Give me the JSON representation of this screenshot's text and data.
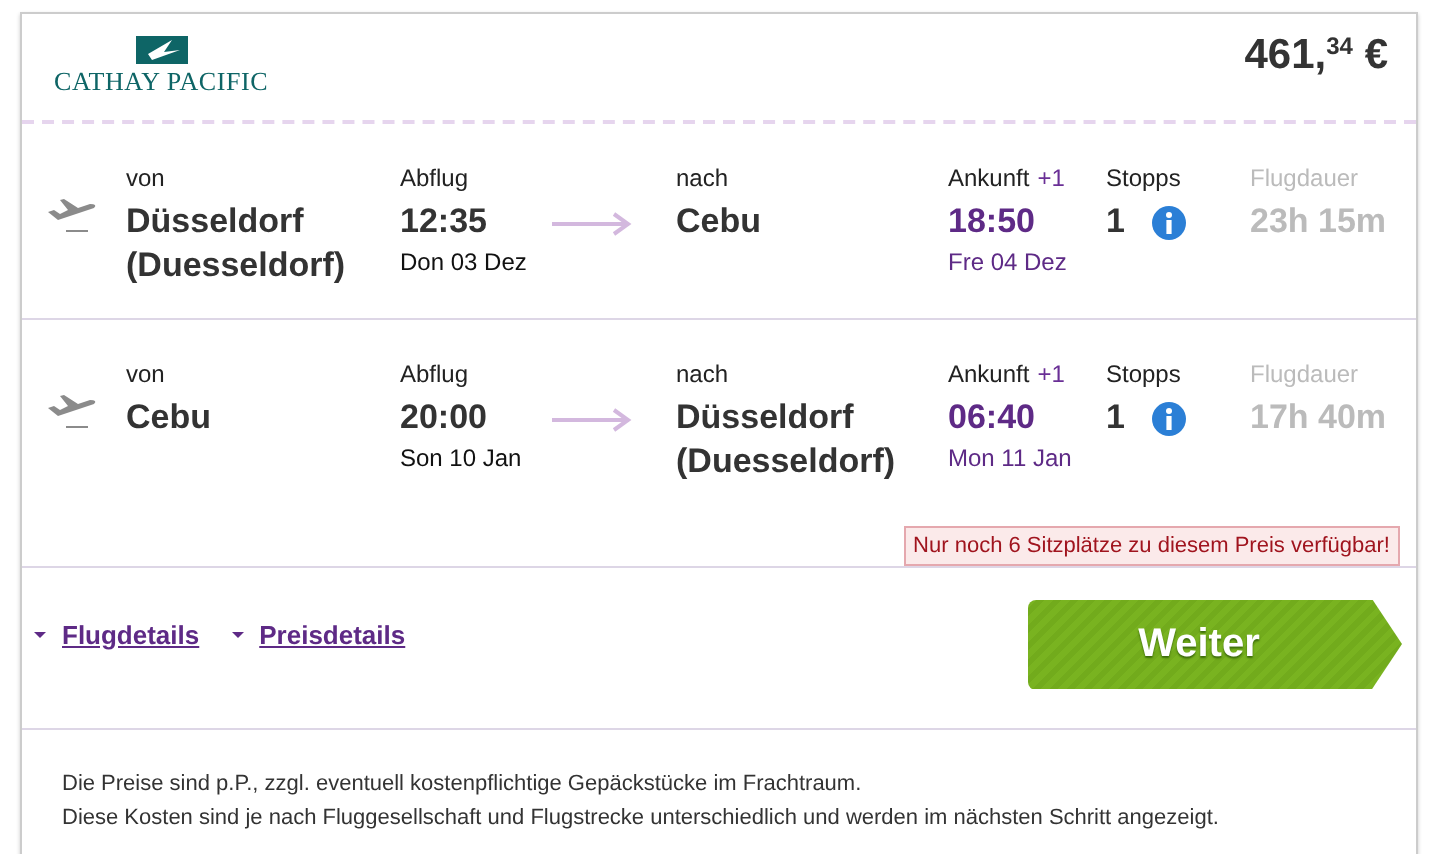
{
  "header": {
    "airline": "CATHAY PACIFIC",
    "price": "461,$^{34}$ €"
  },
  "flights": [
    {
      "from_label": "von",
      "from": "Düsseldorf (Duesseldorf)",
      "dep_label": "Abflug",
      "dep_time": "12:35",
      "dep_date": "Don 03 Dez",
      "to_label": "nach",
      "to": "Cebu",
      "arr_label": "Ankunft",
      "arr_offset": "+1",
      "arr_time": "18:50",
      "arr_date": "Fre 04 Dez",
      "stops_label": "Stopps",
      "stops": "1",
      "duration_label": "Flugdauer",
      "duration": "23h 15m"
    },
    {
      "from_label": "von",
      "from": "Cebu",
      "dep_label": "Abflug",
      "dep_time": "20:00",
      "dep_date": "Son 10 Jan",
      "to_label": "nach",
      "to": "Düsseldorf (Duesseldorf)",
      "arr_label": "Ankunft",
      "arr_offset": "+1",
      "arr_time": "06:40",
      "arr_date": "Mon 11 Jan",
      "stops_label": "Stopps",
      "stops": "1",
      "duration_label": "Flugdauer",
      "duration": "17h 40m",
      "warning": "Nur noch 6 Sitzplätze zu diesem Preis verfügbar!"
    }
  ],
  "links": [
    "Flugdetails",
    "Preisdetails"
  ],
  "continue_button": "Weiter",
  "notes": [
    "Die Preise sind p.P., zzgl. eventuell kostenpflichtige Gepäckstücke im Frachtraum.",
    "Diese Kosten sind je nach Fluggesellschaft und Flugstrecke unterschiedlich und werden im nächsten Schritt angezeigt."
  ]
}
